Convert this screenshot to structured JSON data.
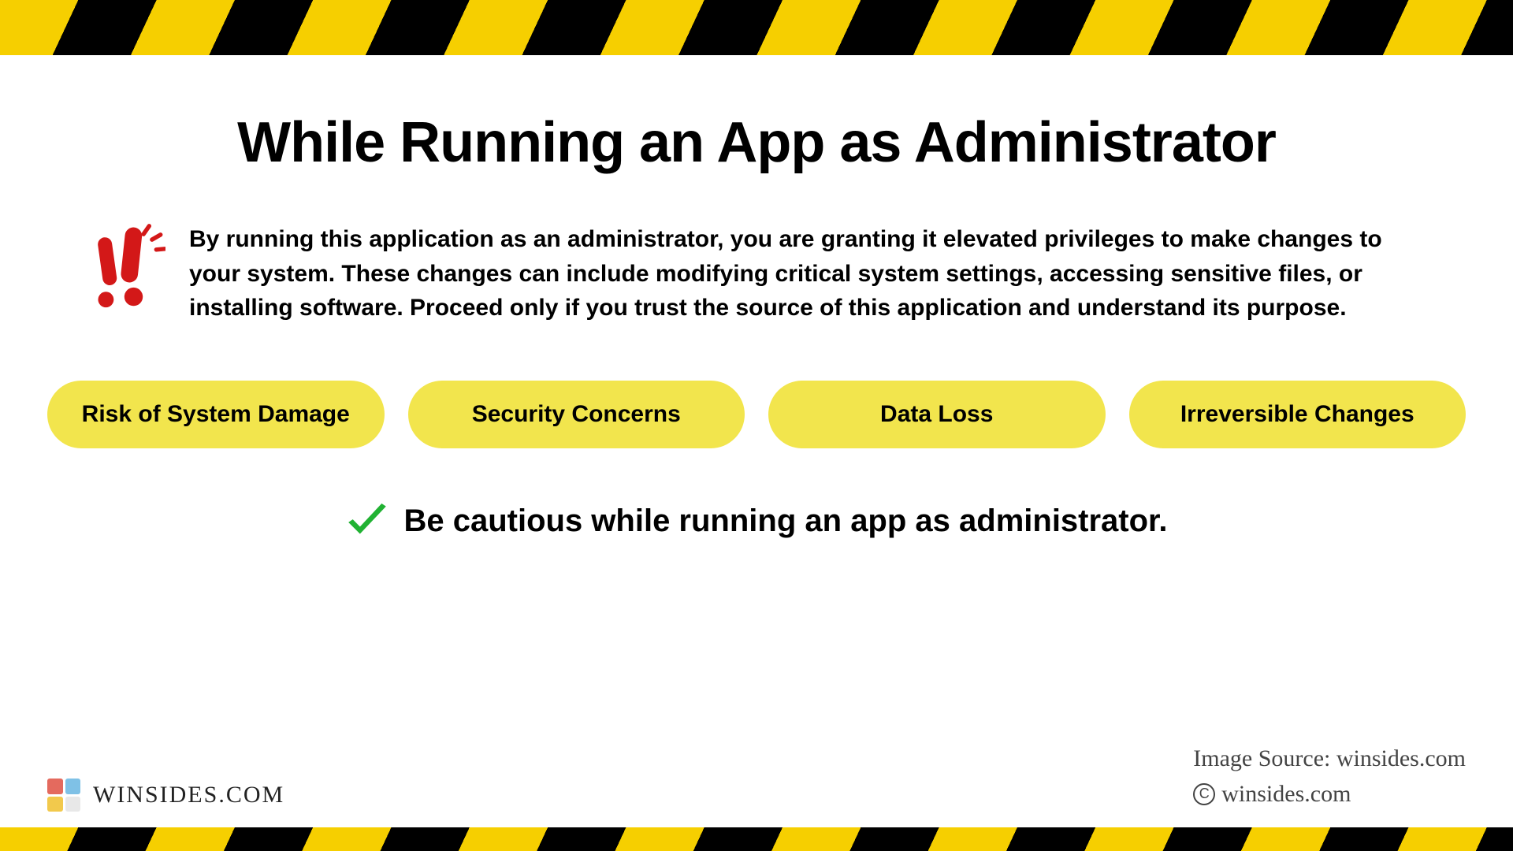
{
  "title": "While Running an App as Administrator",
  "warning_text": "By running this application as an administrator, you are granting it elevated privileges to make changes to your system. These changes can include modifying critical system settings, accessing sensitive files, or installing software. Proceed only if you trust the source of this application and understand its purpose.",
  "pills": [
    "Risk of System Damage",
    "Security Concerns",
    "Data Loss",
    "Irreversible Changes"
  ],
  "caution_text": "Be cautious while running an app as administrator.",
  "brand": "WINSIDES.COM",
  "attribution_source": "Image Source: winsides.com",
  "attribution_copyright": "winsides.com",
  "colors": {
    "pill_bg": "#f2e54d",
    "stripe_yellow": "#f6cf00",
    "exclaim_red": "#d31818",
    "check_green": "#21b233"
  }
}
